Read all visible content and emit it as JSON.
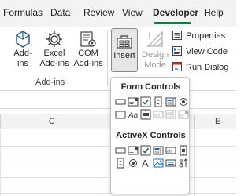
{
  "tabs": [
    {
      "label": "Formulas"
    },
    {
      "label": "Data"
    },
    {
      "label": "Review"
    },
    {
      "label": "View"
    },
    {
      "label": "Developer"
    },
    {
      "label": "Help"
    }
  ],
  "active_tab": "Developer",
  "ribbon": {
    "addins_group": {
      "label": "Add-ins",
      "buttons": [
        {
          "line1": "Add-",
          "line2": "ins"
        },
        {
          "line1": "Excel",
          "line2": "Add-ins"
        },
        {
          "line1": "COM",
          "line2": "Add-ins"
        }
      ]
    },
    "controls_group": {
      "insert_label": "Insert",
      "design_mode_line1": "Design",
      "design_mode_line2": "Mode",
      "properties_label": "Properties",
      "view_code_label": "View Code",
      "run_dialog_label": "Run Dialog"
    }
  },
  "sheet": {
    "column_headers": [
      "C",
      "E"
    ]
  },
  "insert_menu": {
    "form_controls_title": "Form Controls",
    "activex_controls_title": "ActiveX Controls"
  },
  "colors": {
    "accent_green": "#107c41",
    "icon_blue": "#2b579a",
    "icon_teal": "#0f6cbd"
  }
}
